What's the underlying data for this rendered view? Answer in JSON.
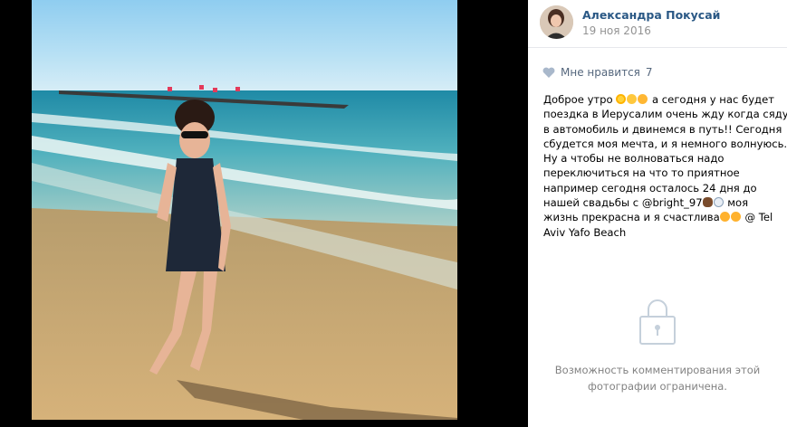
{
  "author": {
    "name": "Александра Покусай",
    "date": "19 ноя 2016"
  },
  "likes": {
    "label": "Мне нравится",
    "count": "7"
  },
  "caption": {
    "l1a": "Доброе утро",
    "l1b": "а сегодня у нас будет",
    "l2": "поездка в Иерусалим очень жду когда сяду",
    "l3": "в автомобиль и двинемся в путь!! Сегодня",
    "l4": "сбудется моя мечта, и я немного волнуюсь.",
    "l5": "Ну а чтобы не волноваться надо",
    "l6": "переключиться на что то приятное",
    "l7": "например сегодня осталось 24 дня до",
    "l8a": "нашей свадьбы с @bright_97",
    "l8b": "моя",
    "l9a": "жизнь прекрасна и я счастлива",
    "l9b": "@ Tel",
    "l10": "Aviv Yafo Beach"
  },
  "comments_notice": {
    "line1": "Возможность комментирования этой",
    "line2": "фотографии ограничена."
  },
  "icons": {
    "like": "heart-icon",
    "lock": "lock-icon"
  },
  "colors": {
    "link": "#2a5885",
    "muted": "#939393"
  }
}
